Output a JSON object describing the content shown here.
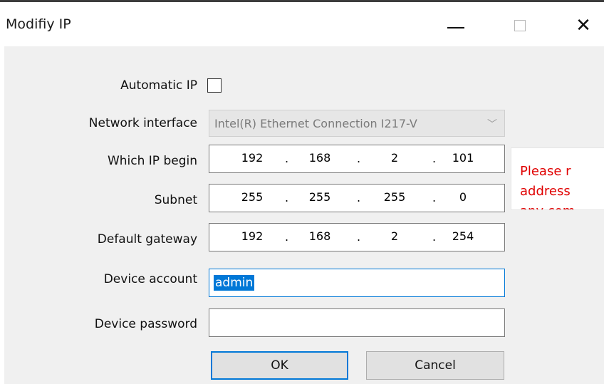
{
  "window": {
    "title": "Modifiy IP",
    "minimize_icon": "minimize-icon",
    "maximize_icon": "maximize-icon",
    "close_icon": "close-icon",
    "close_glyph": "✕"
  },
  "form": {
    "automatic_ip": {
      "label": "Automatic IP",
      "checked": false
    },
    "network_interface": {
      "label": "Network interface",
      "value": "Intel(R) Ethernet Connection I217-V",
      "arrow": "﹀"
    },
    "which_ip_begin": {
      "label": "Which IP begin",
      "octets": [
        "192",
        "168",
        "2",
        "101"
      ]
    },
    "subnet": {
      "label": "Subnet",
      "octets": [
        "255",
        "255",
        "255",
        "0"
      ]
    },
    "default_gateway": {
      "label": "Default gateway",
      "octets": [
        "192",
        "168",
        "2",
        "254"
      ]
    },
    "device_account": {
      "label": "Device account",
      "value": "admin"
    },
    "device_password": {
      "label": "Device password",
      "value": ""
    },
    "ip_separator": "."
  },
  "buttons": {
    "ok": "OK",
    "cancel": "Cancel"
  },
  "note": {
    "lines": [
      "Please r",
      "address",
      "any com"
    ],
    "color": "#e00000"
  }
}
